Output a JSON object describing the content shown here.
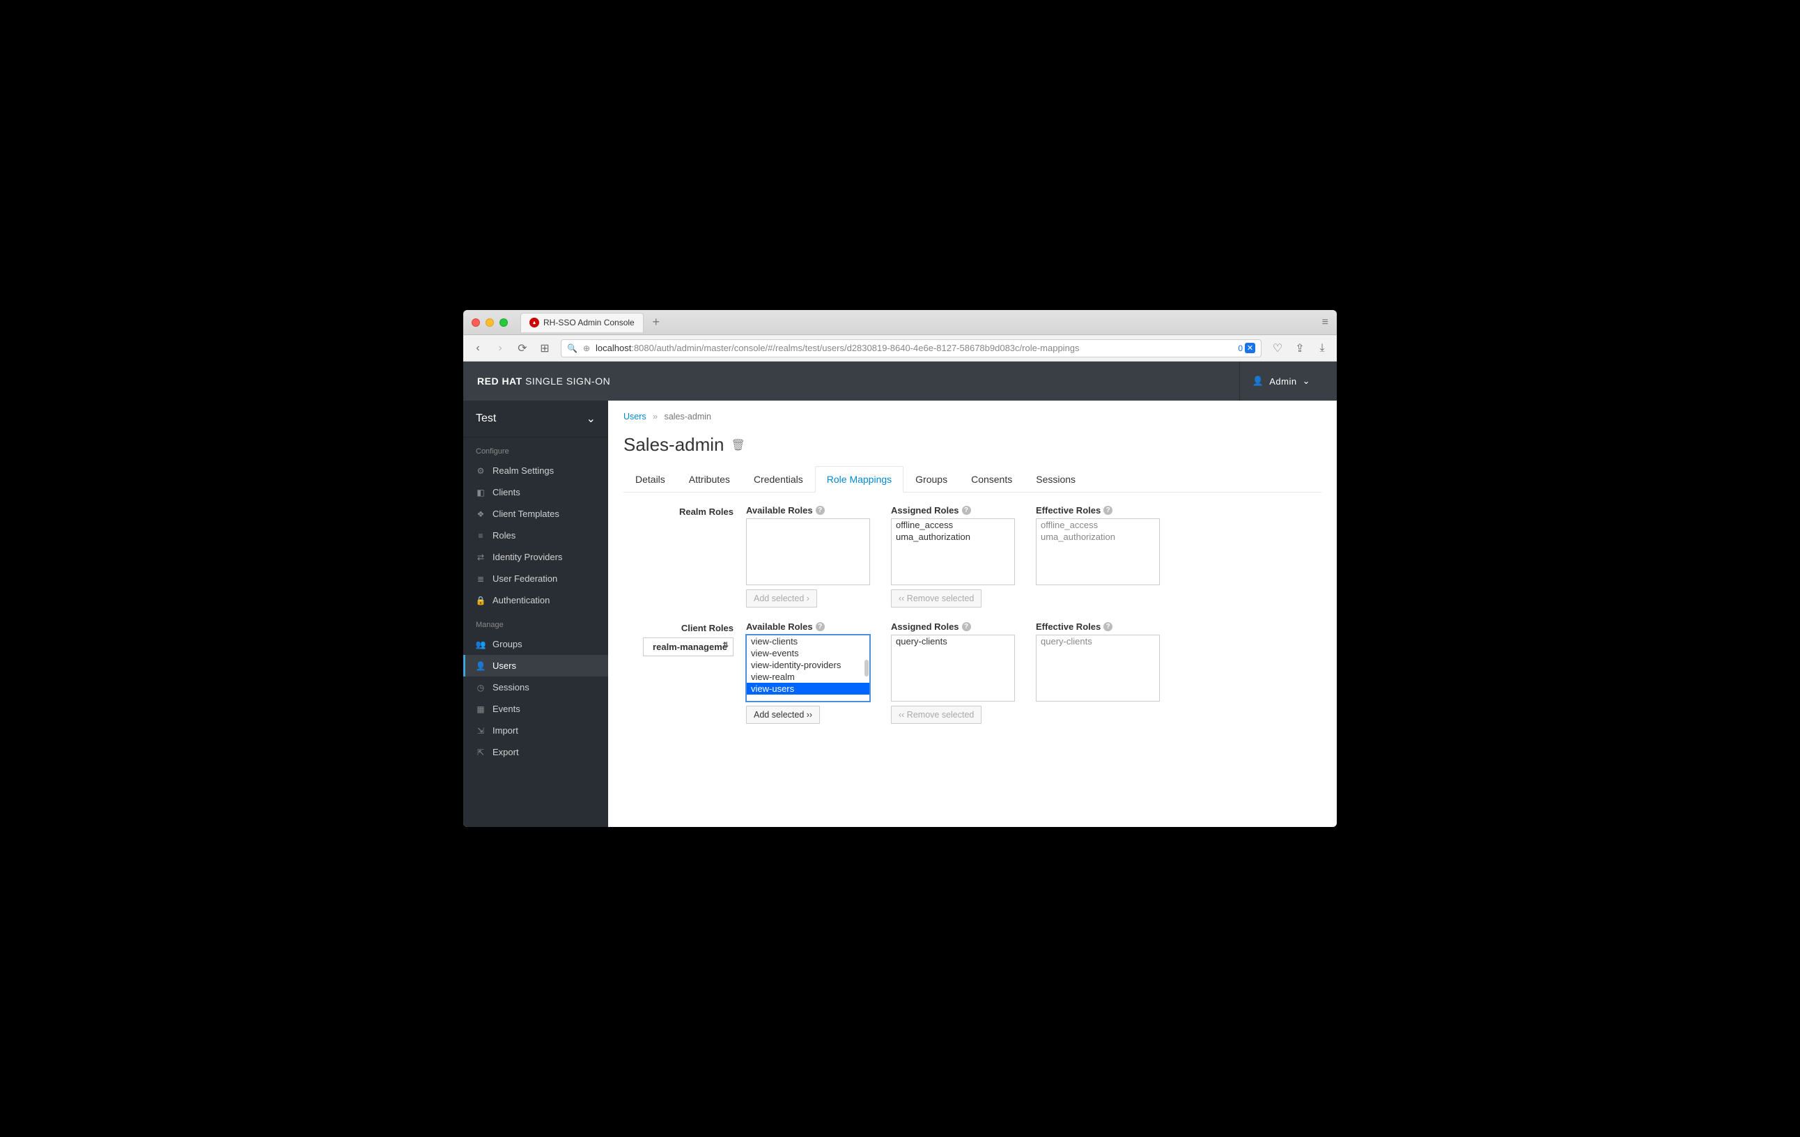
{
  "browser": {
    "tab_title": "RH-SSO Admin Console",
    "url_host": "localhost",
    "url_path": ":8080/auth/admin/master/console/#/realms/test/users/d2830819-8640-4e6e-8127-58678b9d083c/role-mappings",
    "badge_count": "0"
  },
  "header": {
    "brand_bold": "RED HAT",
    "brand_light": "SINGLE SIGN-ON",
    "user": "Admin"
  },
  "sidebar": {
    "realm": "Test",
    "sections": {
      "configure": {
        "label": "Configure",
        "items": [
          "Realm Settings",
          "Clients",
          "Client Templates",
          "Roles",
          "Identity Providers",
          "User Federation",
          "Authentication"
        ]
      },
      "manage": {
        "label": "Manage",
        "items": [
          "Groups",
          "Users",
          "Sessions",
          "Events",
          "Import",
          "Export"
        ]
      }
    },
    "active": "Users"
  },
  "breadcrumbs": {
    "root": "Users",
    "current": "sales-admin"
  },
  "page_title": "Sales-admin",
  "tabs": [
    "Details",
    "Attributes",
    "Credentials",
    "Role Mappings",
    "Groups",
    "Consents",
    "Sessions"
  ],
  "active_tab": "Role Mappings",
  "realm_roles": {
    "label": "Realm Roles",
    "available_label": "Available Roles",
    "assigned_label": "Assigned Roles",
    "effective_label": "Effective Roles",
    "available": [],
    "assigned": [
      "offline_access",
      "uma_authorization"
    ],
    "effective": [
      "offline_access",
      "uma_authorization"
    ],
    "add_btn": "Add selected ›",
    "remove_btn": "‹‹ Remove selected"
  },
  "client_roles": {
    "label": "Client Roles",
    "client_selected": "realm-manageme",
    "available_label": "Available Roles",
    "assigned_label": "Assigned Roles",
    "effective_label": "Effective Roles",
    "available": [
      "view-clients",
      "view-events",
      "view-identity-providers",
      "view-realm",
      "view-users"
    ],
    "available_selected": "view-users",
    "assigned": [
      "query-clients"
    ],
    "effective": [
      "query-clients"
    ],
    "add_btn": "Add selected ››",
    "remove_btn": "‹‹ Remove selected"
  }
}
